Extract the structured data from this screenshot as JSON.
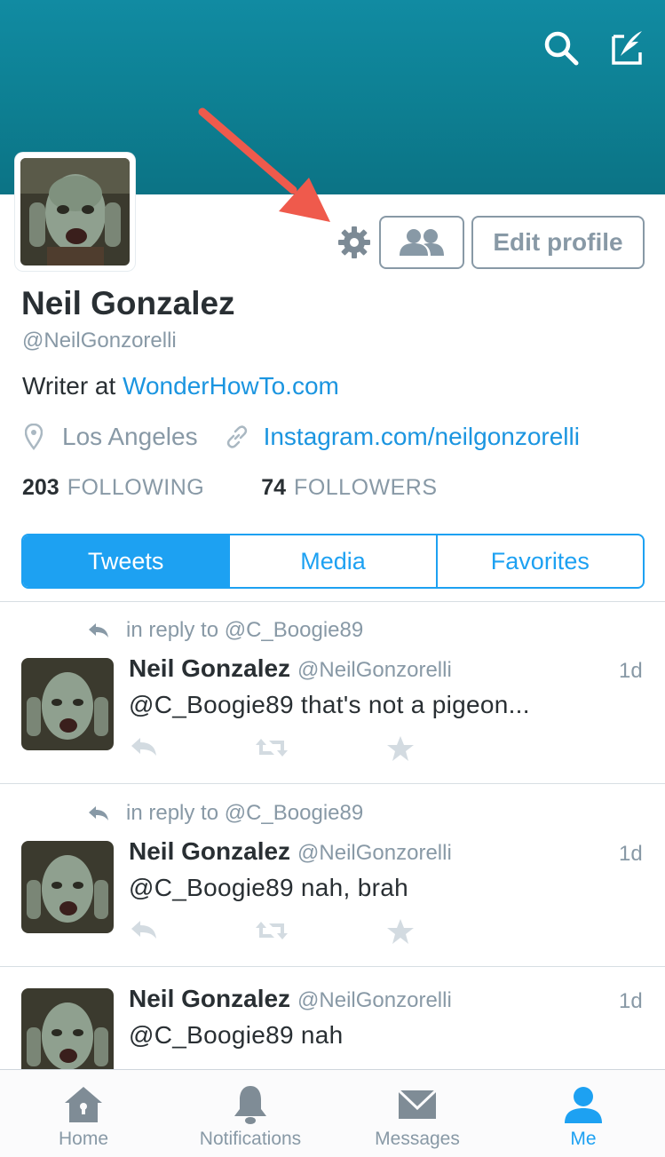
{
  "profile": {
    "name": "Neil Gonzalez",
    "handle": "@NeilGonzorelli",
    "bio_prefix": "Writer at ",
    "bio_link": "WonderHowTo.com",
    "location": "Los Angeles",
    "website": "Instagram.com/neilgonzorelli",
    "following_count": "203",
    "following_label": "FOLLOWING",
    "followers_count": "74",
    "followers_label": "FOLLOWERS",
    "edit_profile_label": "Edit profile"
  },
  "tabs": [
    {
      "label": "Tweets",
      "active": true
    },
    {
      "label": "Media",
      "active": false
    },
    {
      "label": "Favorites",
      "active": false
    }
  ],
  "tweets": [
    {
      "reply_to": "in reply to @C_Boogie89",
      "name": "Neil Gonzalez",
      "handle": "@NeilGonzorelli",
      "time": "1d",
      "text": "@C_Boogie89 that's not a pigeon..."
    },
    {
      "reply_to": "in reply to @C_Boogie89",
      "name": "Neil Gonzalez",
      "handle": "@NeilGonzorelli",
      "time": "1d",
      "text": "@C_Boogie89 nah, brah"
    },
    {
      "name": "Neil Gonzalez",
      "handle": "@NeilGonzorelli",
      "time": "1d",
      "text": "@C_Boogie89 nah"
    }
  ],
  "tabbar": [
    {
      "label": "Home",
      "icon": "home-icon"
    },
    {
      "label": "Notifications",
      "icon": "bell-icon"
    },
    {
      "label": "Messages",
      "icon": "envelope-icon"
    },
    {
      "label": "Me",
      "icon": "person-icon",
      "active": true
    }
  ],
  "colors": {
    "accent": "#1da1f2",
    "banner": "#0f8499",
    "muted": "#8899a6",
    "annotation_arrow": "#ef5a4c"
  }
}
